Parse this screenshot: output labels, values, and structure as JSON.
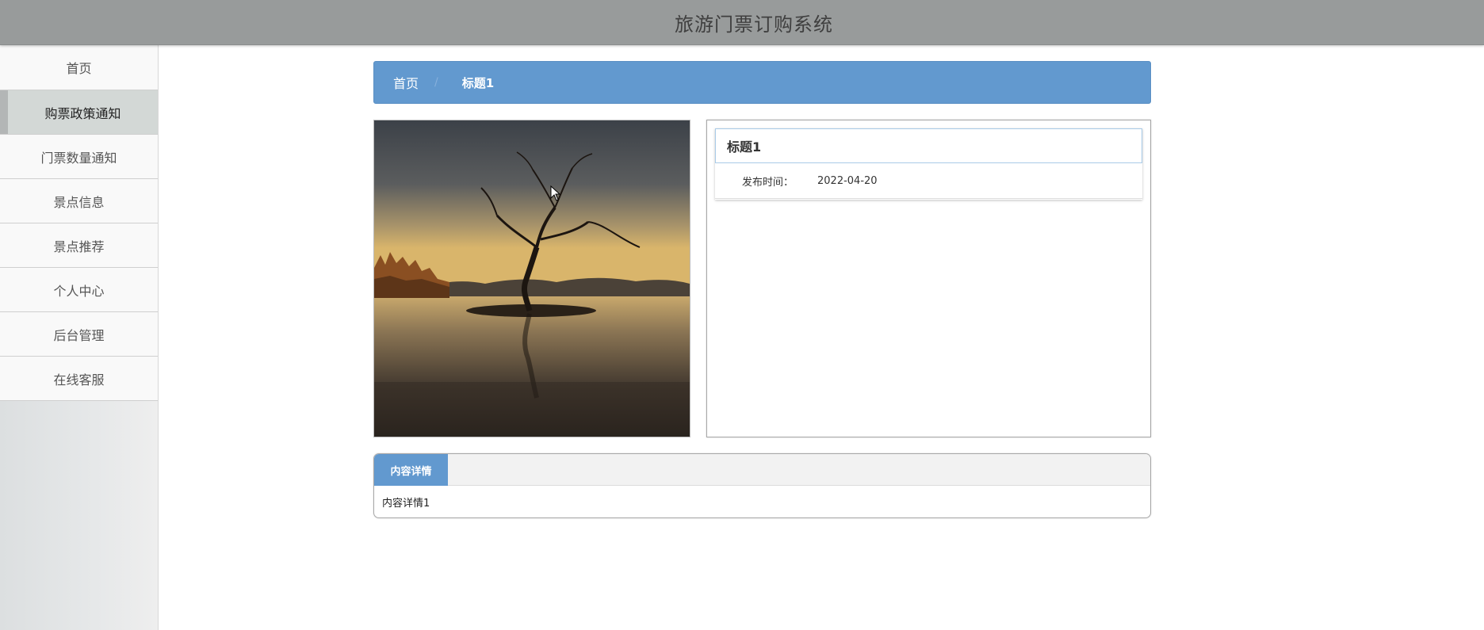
{
  "header": {
    "title": "旅游门票订购系统"
  },
  "sidebar": {
    "items": [
      {
        "label": "首页",
        "active": false
      },
      {
        "label": "购票政策通知",
        "active": true
      },
      {
        "label": "门票数量通知",
        "active": false
      },
      {
        "label": "景点信息",
        "active": false
      },
      {
        "label": "景点推荐",
        "active": false
      },
      {
        "label": "个人中心",
        "active": false
      },
      {
        "label": "后台管理",
        "active": false
      },
      {
        "label": "在线客服",
        "active": false
      }
    ]
  },
  "breadcrumb": {
    "home": "首页",
    "separator": "/",
    "current": "标题1"
  },
  "detail": {
    "title": "标题1",
    "publish_label": "发布时间：",
    "publish_value": "2022-04-20"
  },
  "content": {
    "tab_label": "内容详情",
    "body": "内容详情1"
  },
  "colors": {
    "header_bg": "#989b9b",
    "accent": "#6299cf",
    "active_nav_bg": "#d3d8d6"
  }
}
